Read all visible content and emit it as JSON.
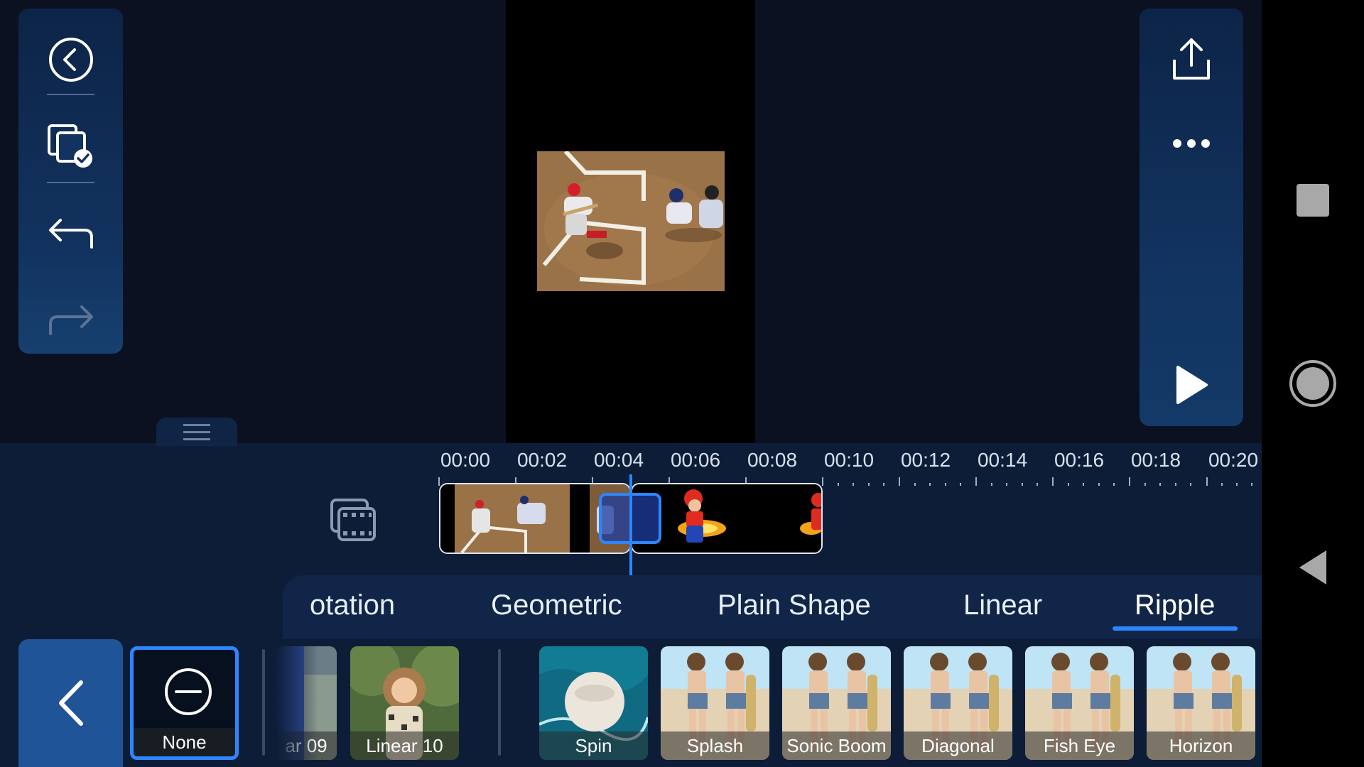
{
  "left_toolbar": {
    "buttons": [
      {
        "name": "back",
        "icon": "circle-back-icon"
      },
      {
        "name": "copy-select",
        "icon": "copy-check-icon"
      },
      {
        "name": "undo",
        "icon": "undo-icon"
      },
      {
        "name": "redo",
        "icon": "redo-icon"
      }
    ]
  },
  "right_toolbar": {
    "buttons": [
      {
        "name": "export",
        "icon": "share-upload-icon"
      },
      {
        "name": "more",
        "icon": "more-dots-icon"
      },
      {
        "name": "play",
        "icon": "play-icon"
      }
    ]
  },
  "timeline": {
    "ruler_labels": [
      "00:00",
      "00:02",
      "00:04",
      "00:06",
      "00:08",
      "00:10",
      "00:12",
      "00:14",
      "00:16",
      "00:18",
      "00:20"
    ]
  },
  "transition_tabs": {
    "items": [
      "otation",
      "Geometric",
      "Plain Shape",
      "Linear",
      "Ripple"
    ],
    "active": "Ripple"
  },
  "thumbnails": {
    "none_label": "None",
    "previous": [
      "ar 09",
      "Linear 10"
    ],
    "ripple": [
      "Spin",
      "Splash",
      "Sonic Boom",
      "Diagonal",
      "Fish Eye",
      "Horizon"
    ]
  },
  "colors": {
    "accent": "#2e86ff",
    "panel": "#0d1d38",
    "toolbar": "#12335f",
    "background": "#0b1120"
  }
}
